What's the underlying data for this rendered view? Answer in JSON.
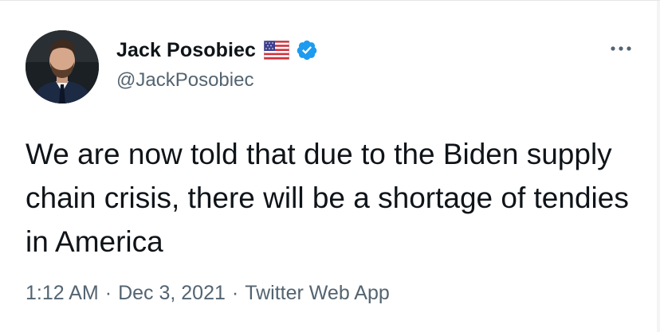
{
  "tweet": {
    "author": {
      "display_name": "Jack Posobiec",
      "handle": "@JackPosobiec",
      "flag_icon": "us-flag-icon",
      "verified_icon": "verified-badge-icon"
    },
    "text": "We are now told that due to the Biden supply chain crisis, there will be a shortage of tendies in America",
    "meta": {
      "time": "1:12 AM",
      "separator": "·",
      "date": "Dec 3, 2021",
      "source": "Twitter Web App"
    },
    "more_icon": "more-options-icon"
  },
  "colors": {
    "text_primary": "#0f1419",
    "text_secondary": "#536471",
    "verified_blue": "#1d9bf0"
  }
}
